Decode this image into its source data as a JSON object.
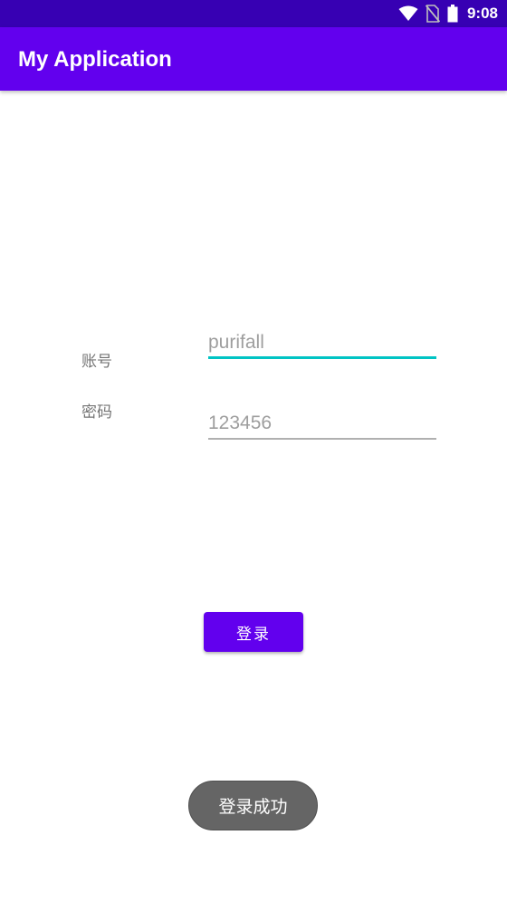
{
  "status_bar": {
    "time": "9:08",
    "icons": [
      "wifi-icon",
      "no-sim-icon",
      "battery-icon"
    ],
    "color": "#3700b3"
  },
  "app_bar": {
    "title": "My Application",
    "color": "#6200ee"
  },
  "form": {
    "username_label": "账号",
    "username_value": "purifall",
    "password_label": "密码",
    "password_value": "123456",
    "focus_accent": "#00c4c4",
    "login_label": "登录"
  },
  "toast": {
    "message": "登录成功"
  }
}
